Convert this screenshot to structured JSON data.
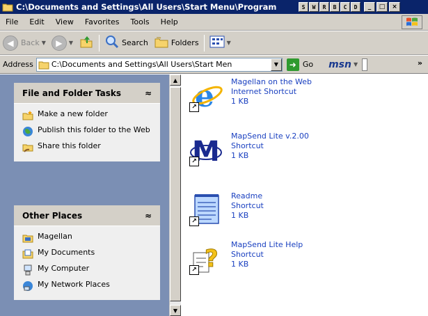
{
  "window": {
    "title": "C:\\Documents and Settings\\All Users\\Start Menu\\Program",
    "mini_buttons": [
      "S",
      "W",
      "R",
      "B",
      "C",
      "D"
    ],
    "controls": [
      "_",
      "□",
      "×"
    ]
  },
  "menubar": {
    "items": [
      "File",
      "Edit",
      "View",
      "Favorites",
      "Tools",
      "Help"
    ]
  },
  "toolbar": {
    "back_label": "Back",
    "search_label": "Search",
    "folders_label": "Folders"
  },
  "addressbar": {
    "label": "Address",
    "value": "C:\\Documents and Settings\\All Users\\Start Men",
    "go_label": "Go",
    "msn_label": "msn",
    "more": "»"
  },
  "tasks_panel": {
    "title": "File and Folder Tasks",
    "collapse": "≈",
    "items": [
      "Make a new folder",
      "Publish this folder to the Web",
      "Share this folder"
    ]
  },
  "places_panel": {
    "title": "Other Places",
    "collapse": "≈",
    "items": [
      "Magellan",
      "My Documents",
      "My Computer",
      "My Network Places"
    ]
  },
  "files": [
    {
      "name": "Magellan on the Web",
      "type": "Internet Shortcut",
      "size": "1 KB",
      "icon": "ie-icon"
    },
    {
      "name": "MapSend Lite v.2.00",
      "type": "Shortcut",
      "size": "1 KB",
      "icon": "mapsend-icon"
    },
    {
      "name": "Readme",
      "type": "Shortcut",
      "size": "1 KB",
      "icon": "notepad-icon"
    },
    {
      "name": "MapSend Lite Help",
      "type": "Shortcut",
      "size": "1 KB",
      "icon": "help-icon"
    }
  ],
  "colors": {
    "titlebar": "#0a246a",
    "taskpane": "#7b8fb4",
    "link": "#1a40c0"
  }
}
